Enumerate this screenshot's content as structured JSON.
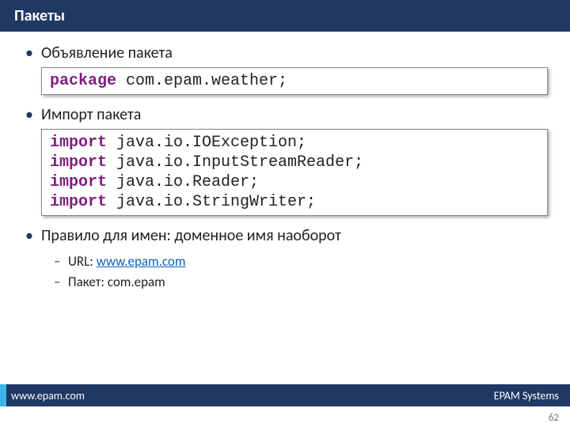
{
  "title": "Пакеты",
  "bullets": {
    "declare": "Объявление пакета",
    "import": "Импорт пакета",
    "rule": "Правило для имен: доменное имя наоборот",
    "url_label": "URL: ",
    "url_value": "www.epam.com",
    "pkg_label": "Пакет: ",
    "pkg_value": "com.epam"
  },
  "code": {
    "kw_package": "package",
    "package_rest": " com.epam.weather;",
    "kw_import": "import",
    "import_lines": [
      " java.io.IOException;",
      " java.io.InputStreamReader;",
      " java.io.Reader;",
      " java.io.StringWriter;"
    ]
  },
  "footer": {
    "left": "www.epam.com",
    "right": "EPAM Systems"
  },
  "page_number": "62"
}
